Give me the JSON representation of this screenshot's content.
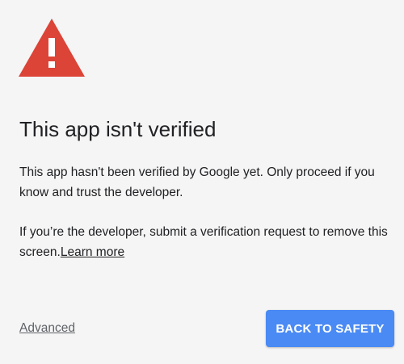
{
  "colors": {
    "warning_red": "#db4437",
    "button_blue": "#4a8af4",
    "background": "#f5f5f5",
    "text": "#202124"
  },
  "icon": {
    "name": "warning-triangle-icon"
  },
  "title": "This app isn't verified",
  "message_1": "This app hasn't been verified by Google yet. Only proceed if you know and trust the developer.",
  "message_2": {
    "text": "If you’re the developer, submit a verification request to remove this screen.",
    "link": "Learn more"
  },
  "actions": {
    "advanced": "Advanced",
    "back_to_safety": "BACK TO SAFETY"
  }
}
